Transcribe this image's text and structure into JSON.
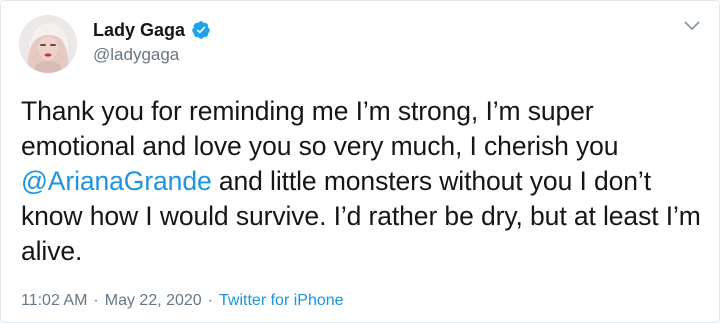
{
  "author": {
    "display_name": "Lady Gaga",
    "handle": "@ladygaga",
    "avatar_icon": "profile-photo",
    "verified_icon": "verified-badge-icon"
  },
  "tweet": {
    "text_part1": "Thank you for reminding me I’m strong, I’m super emotional and love you so very much, I cherish you ",
    "mention": "@ArianaGrande",
    "text_part2": " and little monsters without you I don’t know how I would survive. I’d rather be dry, but at least I’m alive."
  },
  "meta": {
    "time": "11:02 AM",
    "separator": "·",
    "date": "May 22, 2020",
    "source": "Twitter for iPhone"
  },
  "menu_icon": "chevron-down-icon",
  "colors": {
    "accent": "#1b95e0",
    "text": "#14171a",
    "secondary_text": "#657786",
    "border": "#e1e8ed"
  }
}
